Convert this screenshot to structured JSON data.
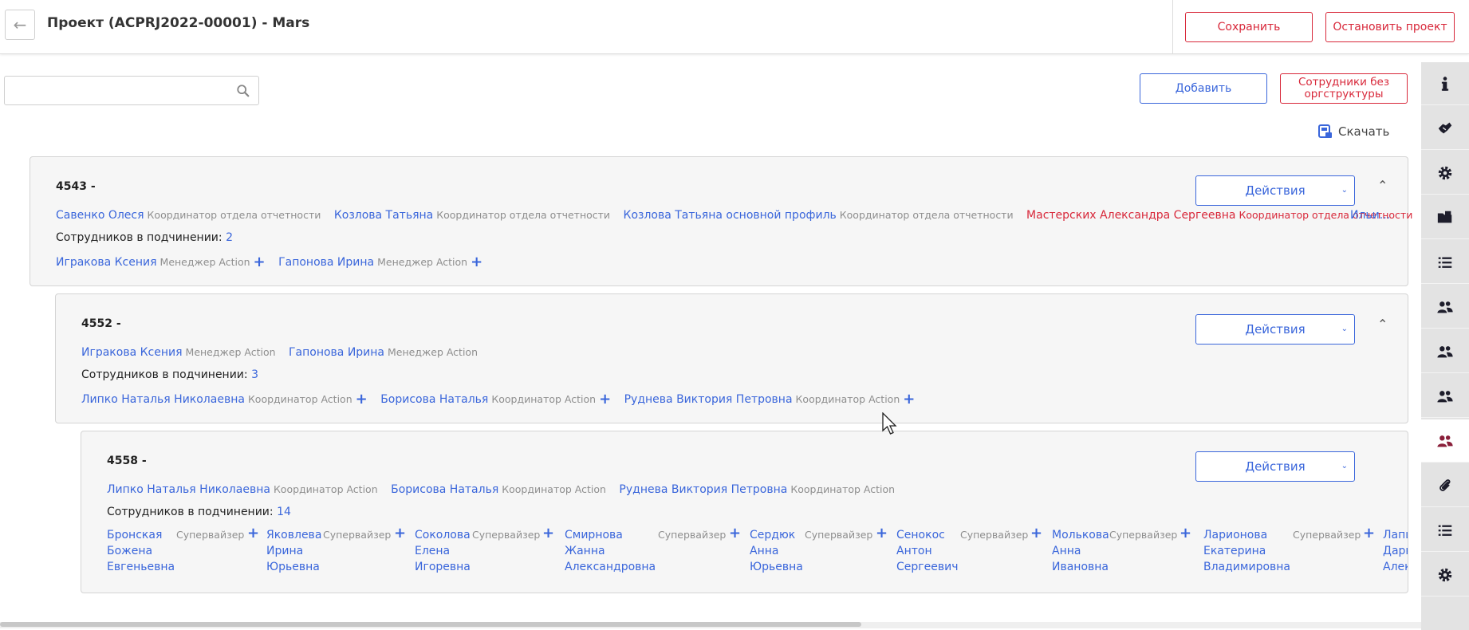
{
  "header": {
    "title": "Проект (ACPRJ2022-00001) - Mars",
    "save_label": "Сохранить",
    "stop_label": "Остановить проект"
  },
  "toolbar": {
    "search_placeholder": "",
    "add_label": "Добавить",
    "no_orgstructure_label": "Сотрудники без оргструктуры",
    "download_label": "Скачать"
  },
  "colors": {
    "accent": "#3a66db",
    "danger": "#d8283a",
    "card_bg": "#f6f6f6",
    "sidebar_bg": "#e3e3e3",
    "active_icon": "#8a1f3a"
  },
  "cards": [
    {
      "title": "4543 -",
      "actions_label": "Действия",
      "members": [
        {
          "name": "Савенко Олеся",
          "role": "Координатор отдела отчетности"
        },
        {
          "name": "Козлова Татьяна",
          "role": "Координатор отдела отчетности"
        },
        {
          "name": "Козлова Татьяна основной профиль",
          "role": "Координатор отдела отчетности"
        },
        {
          "name": "Мастерских Александра Сергеевна",
          "role": "Координатор отдела отчетности"
        },
        {
          "name": "Ильи..."
        }
      ],
      "sub_label": "Сотрудников в подчинении:",
      "sub_count": "2",
      "subordinates": [
        {
          "name": "Игракова Ксения",
          "role": "Менеджер Action"
        },
        {
          "name": "Гапонова Ирина",
          "role": "Менеджер Action"
        }
      ]
    },
    {
      "title": "4552 -",
      "actions_label": "Действия",
      "members": [
        {
          "name": "Игракова Ксения",
          "role": "Менеджер Action"
        },
        {
          "name": "Гапонова Ирина",
          "role": "Менеджер Action"
        }
      ],
      "sub_label": "Сотрудников в подчинении:",
      "sub_count": "3",
      "subordinates": [
        {
          "name": "Липко Наталья Николаевна",
          "role": "Координатор Action"
        },
        {
          "name": "Борисова Наталья",
          "role": "Координатор Action"
        },
        {
          "name": "Руднева Виктория Петровна",
          "role": "Координатор Action"
        }
      ]
    },
    {
      "title": "4558 -",
      "actions_label": "Действия",
      "members": [
        {
          "name": "Липко Наталья Николаевна",
          "role": "Координатор Action"
        },
        {
          "name": "Борисова Наталья",
          "role": "Координатор Action"
        },
        {
          "name": "Руднева Виктория Петровна",
          "role": "Координатор Action"
        }
      ],
      "sub_label": "Сотрудников в подчинении:",
      "sub_count": "14",
      "subordinates": [
        {
          "l1": "Бронская",
          "l2": "Божена",
          "l3": "Евгеньевна",
          "role": "Супервайзер"
        },
        {
          "l1": "Яковлева",
          "l2": "Ирина",
          "l3": "Юрьевна",
          "role": "Супервайзер"
        },
        {
          "l1": "Соколова",
          "l2": "Елена",
          "l3": "Игоревна",
          "role": "Супервайзер"
        },
        {
          "l1": "Смирнова",
          "l2": "Жанна",
          "l3": "Александровна",
          "role": "Супервайзер"
        },
        {
          "l1": "Сердюк",
          "l2": "Анна",
          "l3": "Юрьевна",
          "role": "Супервайзер"
        },
        {
          "l1": "Сенокос",
          "l2": "Антон",
          "l3": "Сергеевич",
          "role": "Супервайзер"
        },
        {
          "l1": "Молькова",
          "l2": "Анна",
          "l3": "Ивановна",
          "role": "Супервайзер"
        },
        {
          "l1": "Ларионова",
          "l2": "Екатерина",
          "l3": "Владимировна",
          "role": "Супервайзер"
        },
        {
          "l1": "Лапши",
          "l2": "Дарья",
          "l3": "Алекса"
        }
      ]
    }
  ],
  "sidebar": {
    "icons": [
      "info-icon",
      "handshake-icon",
      "gear-icon",
      "folder-icon",
      "list-icon",
      "users-icon",
      "users-icon",
      "users-icon",
      "users-icon",
      "paperclip-icon",
      "list-icon",
      "gear-icon"
    ]
  }
}
